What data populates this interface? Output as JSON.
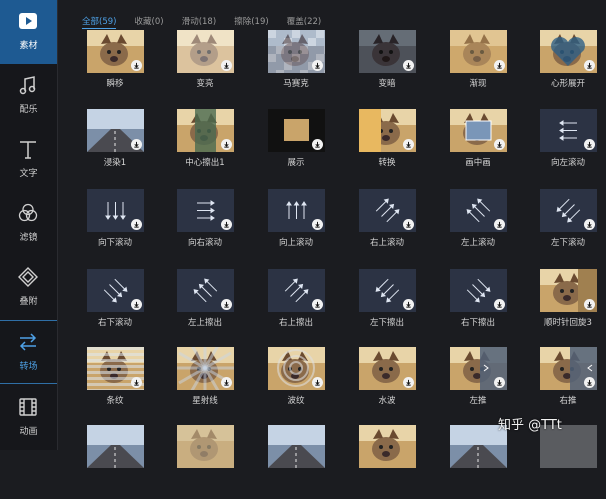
{
  "sidebar": {
    "items": [
      {
        "label": "素材",
        "icon": "play-icon"
      },
      {
        "label": "配乐",
        "icon": "music-note-icon"
      },
      {
        "label": "文字",
        "icon": "text-t-icon"
      },
      {
        "label": "滤镜",
        "icon": "filter-circles-icon"
      },
      {
        "label": "叠附",
        "icon": "layers-icon"
      },
      {
        "label": "转场",
        "icon": "transition-arrows-icon"
      },
      {
        "label": "动画",
        "icon": "film-strip-icon"
      }
    ],
    "active_index": 0,
    "selected_index": 5
  },
  "tabs": [
    {
      "label": "全部(59)"
    },
    {
      "label": "收藏(0)"
    },
    {
      "label": "滑动(18)"
    },
    {
      "label": "擦除(19)"
    },
    {
      "label": "覆盖(22)"
    }
  ],
  "tabs_active_index": 0,
  "grid": {
    "rows": [
      [
        "瞬移",
        "变亮",
        "马赛克",
        "变暗",
        "渐现",
        "心形展开"
      ],
      [
        "浸染1",
        "中心擦出1",
        "展示",
        "转换",
        "画中画",
        "向左滚动"
      ],
      [
        "向下滚动",
        "向右滚动",
        "向上滚动",
        "右上滚动",
        "左上滚动",
        "左下滚动"
      ],
      [
        "右下滚动",
        "左上擦出",
        "右上擦出",
        "左下擦出",
        "右下擦出",
        "顺时针回旋3"
      ],
      [
        "条纹",
        "星射线",
        "波纹",
        "水波",
        "左推",
        "右推"
      ],
      [
        "",
        "",
        "",
        "",
        "",
        ""
      ]
    ]
  },
  "watermark": "知乎 @TTt",
  "colors": {
    "accent": "#4ea1e6",
    "active_bg": "#1e5a92",
    "thumb_blue": "#2c3242"
  }
}
